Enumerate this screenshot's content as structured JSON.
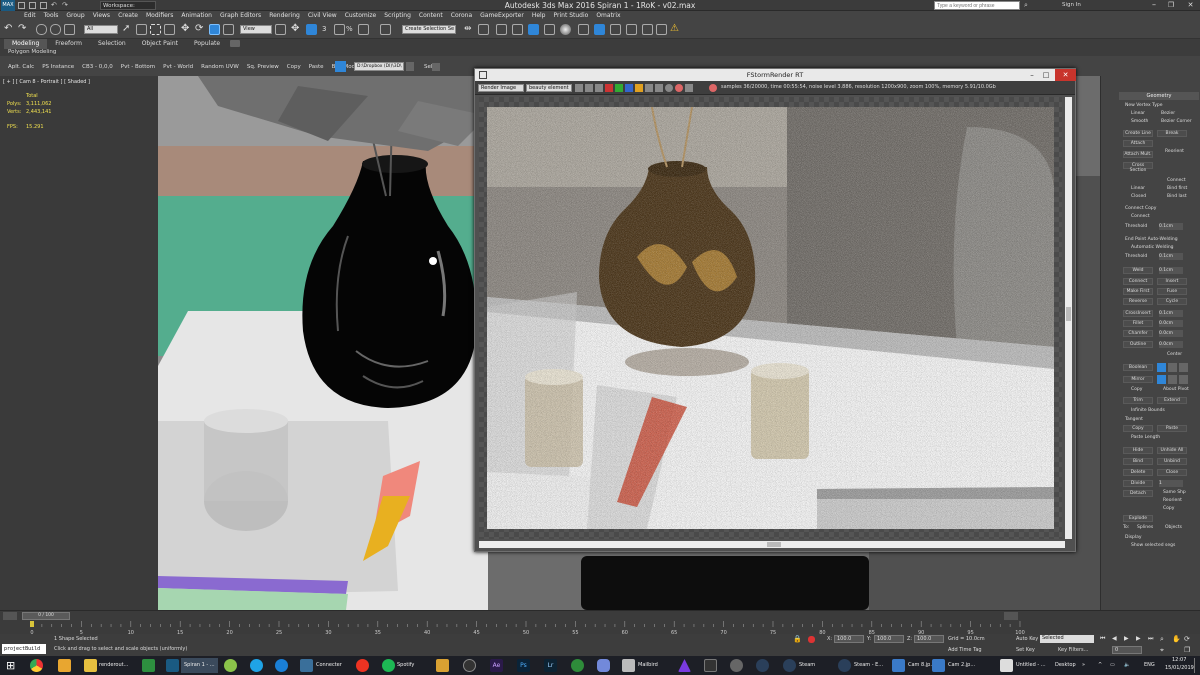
{
  "app": {
    "title": "Autodesk 3ds Max 2016   Spiran 1 - 1RoK - v02.max",
    "workspace": "Workspace: Default",
    "search_placeholder": "Type a keyword or phrase",
    "signin": "Sign In"
  },
  "menu": [
    "Edit",
    "Tools",
    "Group",
    "Views",
    "Create",
    "Modifiers",
    "Animation",
    "Graph Editors",
    "Rendering",
    "Civil View",
    "Customize",
    "Scripting",
    "Content",
    "Corona",
    "GameExporter",
    "Help",
    "Print Studio",
    "Omatrix"
  ],
  "toolbar": {
    "selection_filter": "All",
    "ref_coord": "View",
    "named_sel": "Create Selection Se"
  },
  "ribbon": {
    "tabs": [
      "Modeling",
      "Freeform",
      "Selection",
      "Object Paint",
      "Populate"
    ],
    "active": "Modeling",
    "sub": "Polygon Modeling"
  },
  "subtoolbar": [
    "Aplt. Calc",
    "PS Instance",
    "CB3 - 0,0,0",
    "Pvt - Bottom",
    "Pvt - World",
    "Random UVW",
    "Sq. Preview",
    "Copy",
    "Paste",
    "Box Mode"
  ],
  "path_box": "D:\\Dropbox (DI)\\3D\\",
  "sel_label": "Sel",
  "viewport": {
    "label": "[ + ] [ Cam 8 - Portrait ] [ Shaded ]",
    "stats_header": "Total",
    "polys_label": "Polys:",
    "polys": "3,111,062",
    "verts_label": "Verts:",
    "verts": "2,443,141",
    "fps_label": "FPS:",
    "fps": "15.291"
  },
  "render_window": {
    "title": "FStormRender RT",
    "channel": "Render Image",
    "element": "beauty element",
    "status": "samples 36/20000,  time 00:55:54,  noise level 3.886,  resolution 1200x900,  zoom 100%,  memory 5.91/10.0Gb",
    "min": "–",
    "max": "□",
    "close": "✕"
  },
  "right_panel": {
    "header": "Geometry",
    "new_vertex_type": "New Vertex Type",
    "linear": "Linear",
    "bezier": "Bezier",
    "smooth": "Smooth",
    "bezier_corner": "Bezier Corner",
    "create_line": "Create Line",
    "break": "Break",
    "attach": "Attach",
    "reorient": "Reorient",
    "attach_mult": "Attach Mult.",
    "cross_section": "Cross Section",
    "connect": "Connect",
    "linear2": "Linear",
    "bind_first": "Bind first",
    "closed": "Closed",
    "bind_last": "Bind last",
    "connect_copy": "Connect Copy",
    "connect2": "Connect",
    "threshold": "Threshold",
    "threshold_val": "0.1cm",
    "end_point_welding": "End Point Auto-Welding",
    "automatic_welding": "Automatic Welding",
    "threshold2": "Threshold",
    "threshold2_val": "0.1cm",
    "weld": "Weld",
    "weld_val": "0.1cm",
    "connect3": "Connect",
    "insert": "Insert",
    "make_first": "Make First",
    "fuse": "Fuse",
    "reverse": "Reverse",
    "cycle": "Cycle",
    "crossinsert": "CrossInsert",
    "crossinsert_val": "0.1cm",
    "fillet": "Fillet",
    "fillet_val": "0.0cm",
    "chamfer": "Chamfer",
    "chamfer_val": "0.0cm",
    "outline": "Outline",
    "outline_val": "0.0cm",
    "center": "Center",
    "boolean": "Boolean",
    "mirror": "Mirror",
    "copy": "Copy",
    "about_pivot": "About Pivot",
    "trim": "Trim",
    "extend": "Extend",
    "infinite_bounds": "Infinite Bounds",
    "tangent": "Tangent",
    "copy2": "Copy",
    "paste": "Paste",
    "paste_length": "Paste Length",
    "hide": "Hide",
    "unhide_all": "Unhide All",
    "bind": "Bind",
    "unbind": "Unbind",
    "delete": "Delete",
    "close": "Close",
    "divide": "Divide",
    "divide_val": "1",
    "detach": "Detach",
    "same_shp": "Same Shp",
    "reorient2": "Reorient",
    "copy3": "Copy",
    "explode": "Explode",
    "to": "To:",
    "splines": "Splines",
    "objects": "Objects",
    "display": "Display",
    "show_selected_segs": "Show selected segs"
  },
  "timeline": {
    "frame": "0 / 100",
    "ticks": [
      "0",
      "5",
      "10",
      "15",
      "20",
      "25",
      "30",
      "35",
      "40",
      "45",
      "50",
      "55",
      "60",
      "65",
      "70",
      "75",
      "80",
      "85",
      "90",
      "95",
      "100"
    ]
  },
  "status": {
    "selected": "1 Shape Selected",
    "prompt": "Click and drag to select and scale objects (uniformly)",
    "maxscript": "projectBuild",
    "x_label": "X:",
    "x": "100.0",
    "y_label": "Y:",
    "y": "100.0",
    "z_label": "Z:",
    "z": "100.0",
    "grid": "Grid = 10.0cm",
    "add_time_tag": "Add Time Tag",
    "auto_key": "Auto Key",
    "set_key": "Set Key",
    "selected_dd": "Selected",
    "key_filters": "Key Filters...",
    "frame_val": "0"
  },
  "taskbar": {
    "items": [
      "renderout...",
      "Spiran 1 - ...",
      "Connecter",
      "Spotify",
      "Mailbird",
      "Steam",
      "Steam - E...",
      "Cam 8.jp...",
      "Cam 2.jp...",
      "Untitled - ..."
    ],
    "desktop": "Desktop",
    "lang": "ENG",
    "time": "12:07",
    "date": "15/01/2019"
  },
  "colors": {
    "accent": "#2f86d8",
    "render_close": "#c8342c",
    "frame_marker": "#d8c43a"
  }
}
